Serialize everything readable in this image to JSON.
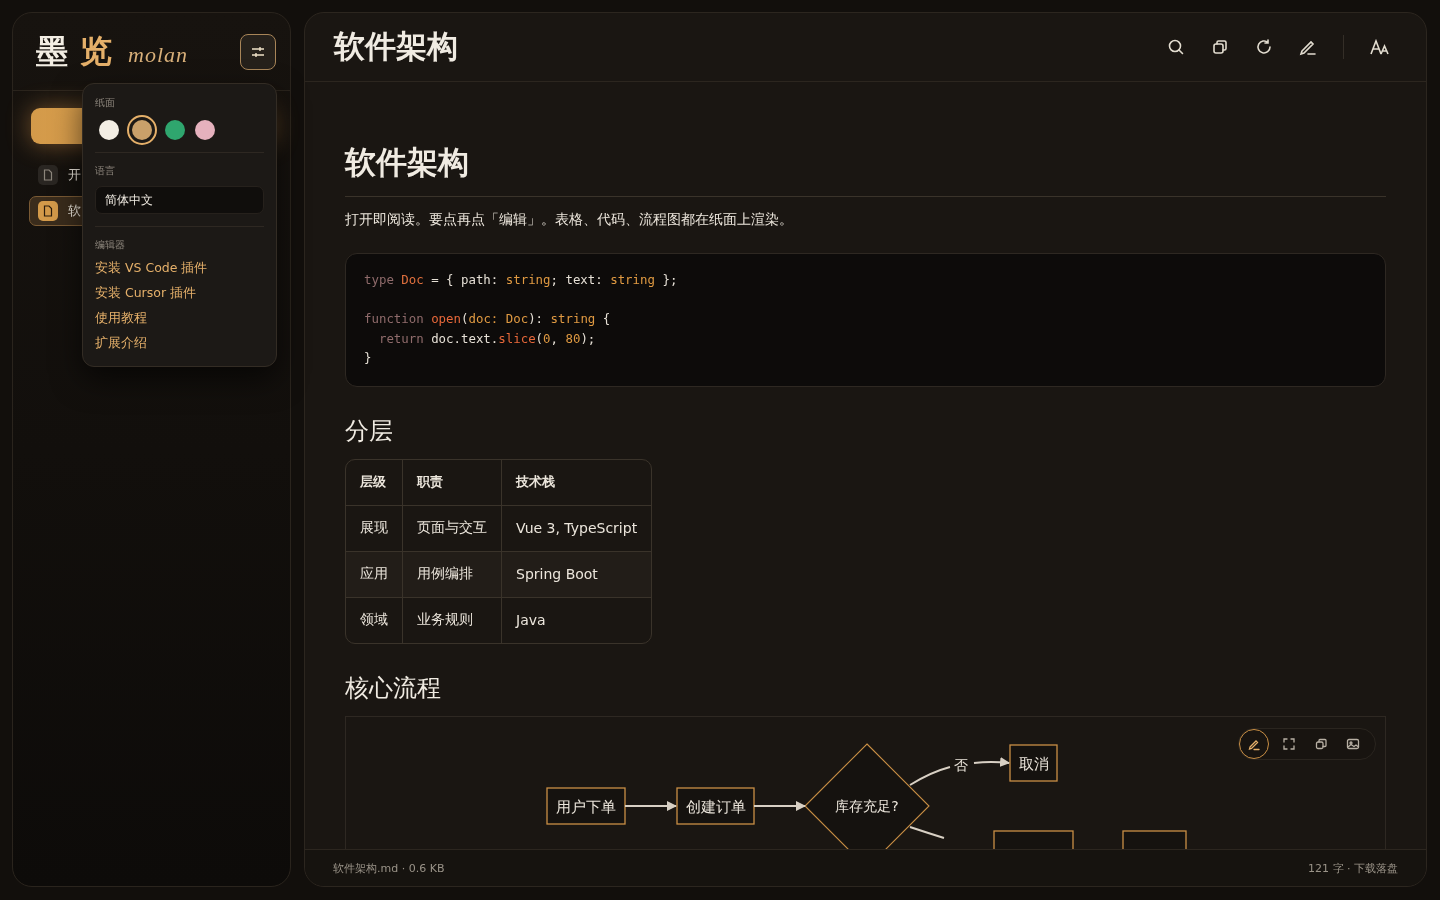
{
  "sidebar": {
    "logo": {
      "main": "墨",
      "accent": "览",
      "latin": "molan"
    },
    "files": [
      {
        "label": "开",
        "selected": false
      },
      {
        "label": "软",
        "selected": true
      }
    ]
  },
  "settings_popover": {
    "paper_label": "纸面",
    "paper_colors": [
      {
        "color": "#f3eee4",
        "selected": false
      },
      {
        "color": "#c9a06a",
        "selected": true
      },
      {
        "color": "#2fa66e",
        "selected": false
      },
      {
        "color": "#e5b1bd",
        "selected": false
      }
    ],
    "language_label": "语言",
    "language_value": "简体中文",
    "editor_label": "编辑器",
    "editor_links": [
      "安装 VS Code 插件",
      "安装 Cursor 插件",
      "使用教程",
      "扩展介绍"
    ]
  },
  "header": {
    "title": "软件架构"
  },
  "document": {
    "heading": "软件架构",
    "intro": "打开即阅读。要点再点「编辑」。表格、代码、流程图都在纸面上渲染。",
    "code": [
      {
        "lines": [
          {
            "tokens": [
              {
                "text": "type",
                "kind": "keyword"
              },
              {
                "text": " Doc",
                "kind": "type"
              },
              {
                "text": " = { path: ",
                "kind": "plain"
              },
              {
                "text": "string",
                "kind": "builtin"
              },
              {
                "text": "; text: ",
                "kind": "plain"
              },
              {
                "text": "string",
                "kind": "builtin"
              },
              {
                "text": " };",
                "kind": "plain"
              }
            ]
          }
        ]
      },
      {
        "lines": [
          {
            "tokens": [
              {
                "text": "function",
                "kind": "keyword"
              },
              {
                "text": " open",
                "kind": "fn"
              },
              {
                "text": "(",
                "kind": "plain"
              },
              {
                "text": "doc: Doc",
                "kind": "builtin"
              },
              {
                "text": "): ",
                "kind": "plain"
              },
              {
                "text": "string",
                "kind": "builtin"
              },
              {
                "text": " {",
                "kind": "plain"
              }
            ]
          },
          {
            "tokens": [
              {
                "text": "  return",
                "kind": "keyword"
              },
              {
                "text": " doc.text.",
                "kind": "plain"
              },
              {
                "text": "slice",
                "kind": "fn"
              },
              {
                "text": "(",
                "kind": "plain"
              },
              {
                "text": "0",
                "kind": "builtin"
              },
              {
                "text": ", ",
                "kind": "plain"
              },
              {
                "text": "80",
                "kind": "builtin"
              },
              {
                "text": ");",
                "kind": "plain"
              }
            ]
          },
          {
            "tokens": [
              {
                "text": "}",
                "kind": "plain"
              }
            ]
          }
        ]
      }
    ],
    "section_layers": "分层",
    "table": {
      "columns": [
        "层级",
        "职责",
        "技术栈"
      ],
      "rows": [
        [
          "展现",
          "页面与交互",
          "Vue 3, TypeScript"
        ],
        [
          "应用",
          "用例编排",
          "Spring Boot"
        ],
        [
          "领域",
          "业务规则",
          "Java"
        ]
      ]
    },
    "section_flow": "核心流程",
    "flowchart": {
      "nodes": [
        {
          "label": "用户下单",
          "kind": "box"
        },
        {
          "label": "创建订单",
          "kind": "box"
        },
        {
          "label": "库存充足?",
          "kind": "diamond"
        },
        {
          "label": "取消",
          "kind": "box"
        }
      ],
      "edge_label": "否"
    }
  },
  "status_bar": {
    "left": "软件架构.md · 0.6 KB",
    "right": "121 字 · 下载落盘"
  }
}
